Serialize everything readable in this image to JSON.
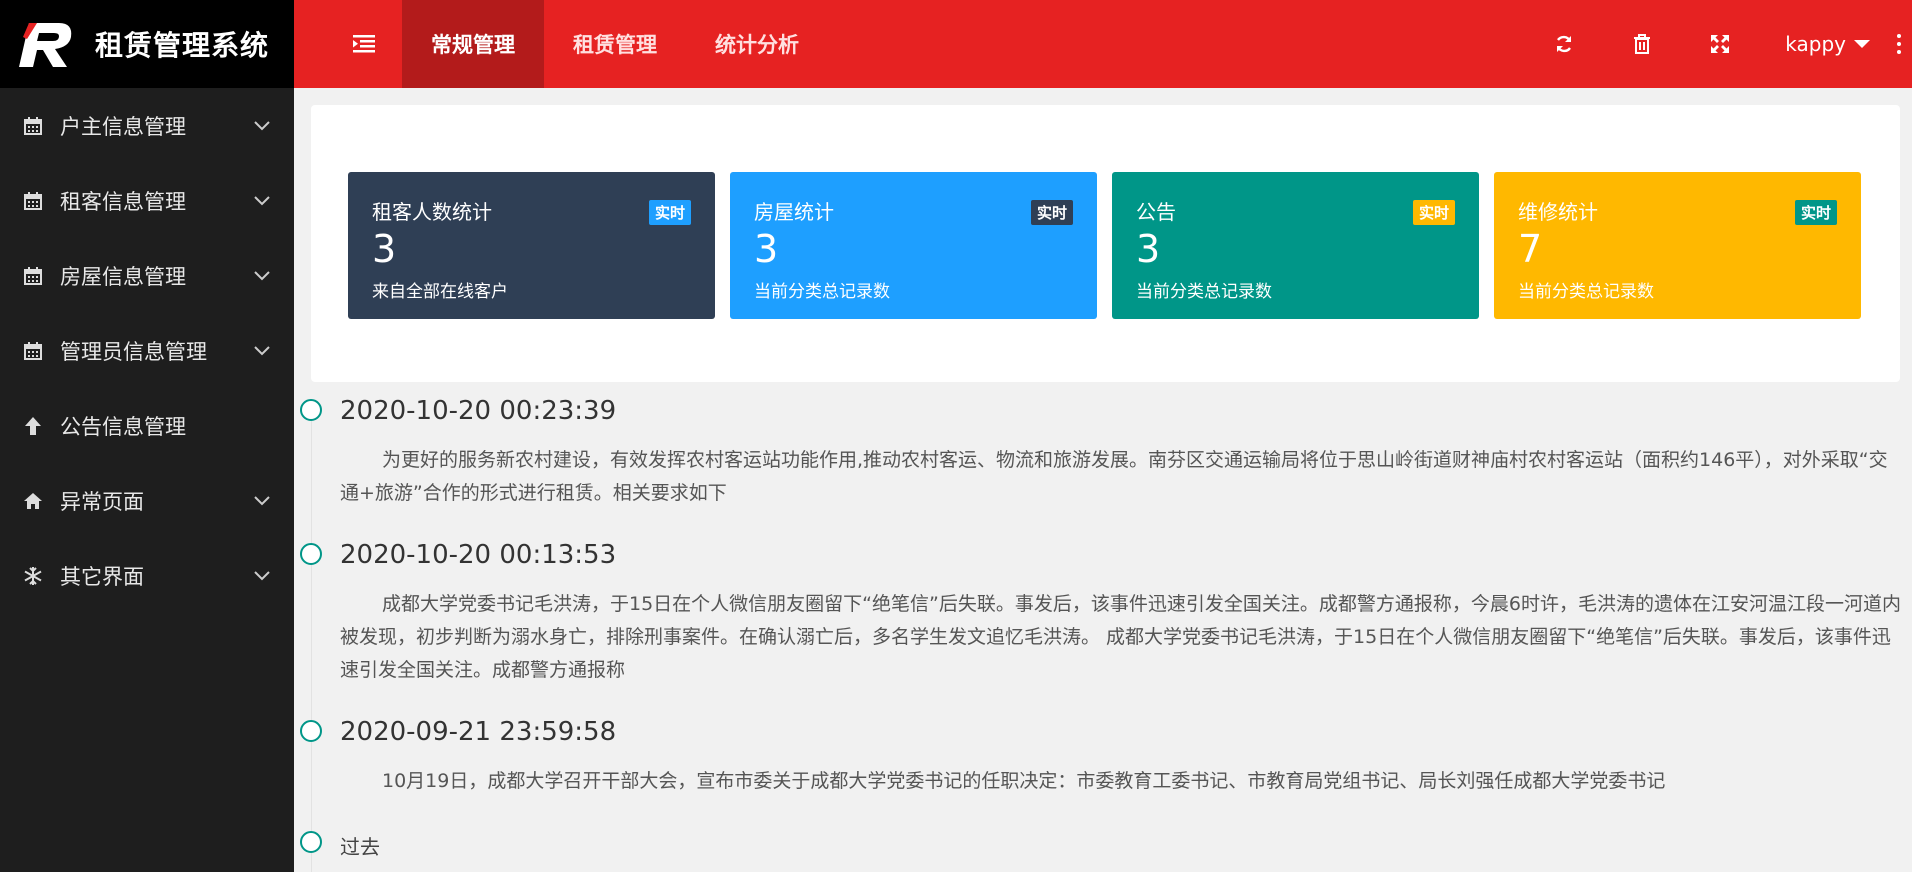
{
  "app": {
    "title": "租赁管理系统"
  },
  "sidebar": {
    "items": [
      {
        "label": "户主信息管理",
        "icon": "calendar-icon",
        "has_arrow": true
      },
      {
        "label": "租客信息管理",
        "icon": "calendar-icon",
        "has_arrow": true
      },
      {
        "label": "房屋信息管理",
        "icon": "calendar-icon",
        "has_arrow": true
      },
      {
        "label": "管理员信息管理",
        "icon": "calendar-icon",
        "has_arrow": true
      },
      {
        "label": "公告信息管理",
        "icon": "arrow-up-icon",
        "has_arrow": false
      },
      {
        "label": "异常页面",
        "icon": "home-icon",
        "has_arrow": true
      },
      {
        "label": "其它界面",
        "icon": "snowflake-icon",
        "has_arrow": true
      }
    ]
  },
  "header": {
    "tabs": [
      {
        "label": "常规管理",
        "active": true
      },
      {
        "label": "租赁管理",
        "active": false
      },
      {
        "label": "统计分析",
        "active": false
      }
    ],
    "icons": [
      "refresh-icon",
      "trash-icon",
      "fullscreen-icon"
    ],
    "user": "kappy"
  },
  "stats": [
    {
      "title": "租客人数统计",
      "badge": "实时",
      "value": "3",
      "desc": "来自全部在线客户",
      "bg": "#2f3f55",
      "badge_bg": "#1e9fff",
      "badge_color": "#ffffff"
    },
    {
      "title": "房屋统计",
      "badge": "实时",
      "value": "3",
      "desc": "当前分类总记录数",
      "bg": "#1e9fff",
      "badge_bg": "#2f3f55",
      "badge_color": "#ffffff"
    },
    {
      "title": "公告",
      "badge": "实时",
      "value": "3",
      "desc": "当前分类总记录数",
      "bg": "#009688",
      "badge_bg": "#ffb800",
      "badge_color": "#ffffff"
    },
    {
      "title": "维修统计",
      "badge": "实时",
      "value": "7",
      "desc": "当前分类总记录数",
      "bg": "#ffb800",
      "badge_bg": "#009688",
      "badge_color": "#ffffff"
    }
  ],
  "timeline": {
    "items": [
      {
        "date": "2020-10-20 00:23:39",
        "text": "为更好的服务新农村建设，有效发挥农村客运站功能作用,推动农村客运、物流和旅游发展。南芬区交通运输局将位于思山岭街道财神庙村农村客运站（面积约146平），对外采取“交通+旅游”合作的形式进行租赁。相关要求如下"
      },
      {
        "date": "2020-10-20 00:13:53",
        "text": "成都大学党委书记毛洪涛，于15日在个人微信朋友圈留下“绝笔信”后失联。事发后，该事件迅速引发全国关注。成都警方通报称，今晨6时许，毛洪涛的遗体在江安河温江段一河道内被发现，初步判断为溺水身亡，排除刑事案件。在确认溺亡后，多名学生发文追忆毛洪涛。 成都大学党委书记毛洪涛，于15日在个人微信朋友圈留下“绝笔信”后失联。事发后，该事件迅速引发全国关注。成都警方通报称"
      },
      {
        "date": "2020-09-21 23:59:58",
        "text": "10月19日，成都大学召开干部大会，宣布市委关于成都大学党委书记的任职决定：市委教育工委书记、市教育局党组书记、局长刘强任成都大学党委书记"
      }
    ],
    "past_label": "过去"
  },
  "colors": {
    "header_red": "#e62222",
    "tab_active": "#b31b1b",
    "sidebar_bg": "#1e1e1e",
    "timeline_dot": "#009688"
  }
}
